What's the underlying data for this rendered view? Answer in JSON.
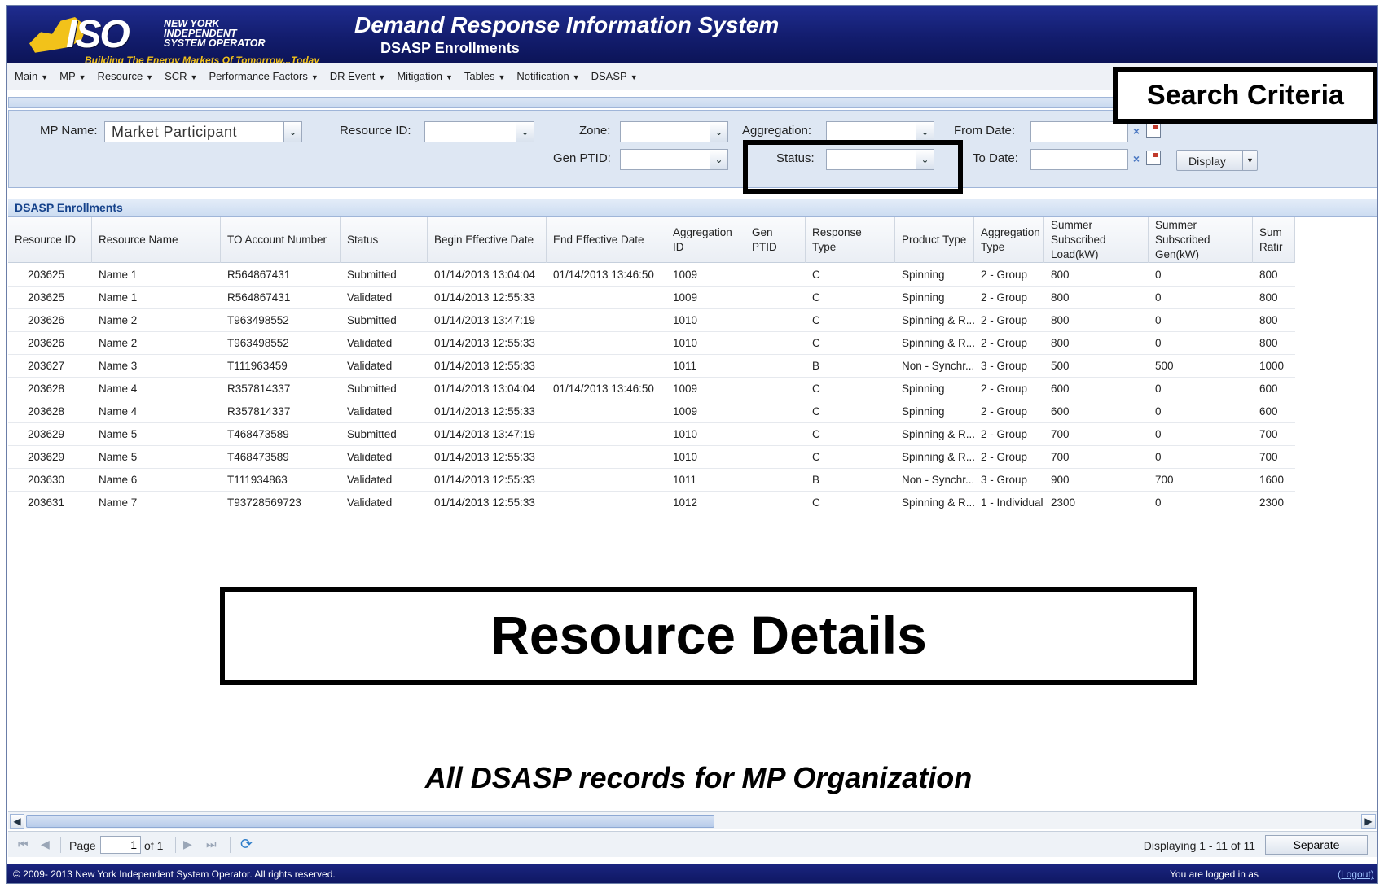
{
  "header": {
    "logo_text": "ISO",
    "org_name": "NEW YORK\nINDEPENDENT\nSYSTEM OPERATOR",
    "tagline": "Building The Energy Markets Of Tomorrow...Today",
    "title": "Demand Response Information System",
    "subtitle": "DSASP Enrollments"
  },
  "menu": [
    "Main",
    "MP",
    "Resource",
    "SCR",
    "Performance Factors",
    "DR Event",
    "Mitigation",
    "Tables",
    "Notification",
    "DSASP"
  ],
  "search": {
    "mp_name_label": "MP Name:",
    "mp_name_value": "Market Participant",
    "resource_id_label": "Resource ID:",
    "zone_label": "Zone:",
    "aggregation_label": "Aggregation:",
    "from_date_label": "From Date:",
    "gen_ptid_label": "Gen PTID:",
    "status_label": "Status:",
    "to_date_label": "To Date:",
    "display_button": "Display",
    "clear_symbol": "×",
    "dropdown_symbol": "⌄"
  },
  "annotations": {
    "search_criteria": "Search Criteria",
    "resource_details": "Resource Details",
    "caption": "All DSASP records for MP Organization"
  },
  "grid": {
    "title": "DSASP Enrollments",
    "columns": [
      "Resource ID",
      "Resource Name",
      "TO Account Number",
      "Status",
      "Begin Effective Date",
      "End Effective Date",
      "Aggregation ID",
      "Gen PTID",
      "Response Type",
      "Product Type",
      "Aggregation Type",
      "Summer Subscribed Load(kW)",
      "Summer Subscribed Gen(kW)",
      "Sum Ratir"
    ],
    "rows": [
      [
        "203625",
        "Name 1",
        "R564867431",
        "Submitted",
        "01/14/2013 13:04:04",
        "01/14/2013 13:46:50",
        "1009",
        "",
        "C",
        "Spinning",
        "2 - Group",
        "800",
        "0",
        "800"
      ],
      [
        "203625",
        "Name 1",
        "R564867431",
        "Validated",
        "01/14/2013 12:55:33",
        "",
        "1009",
        "",
        "C",
        "Spinning",
        "2 - Group",
        "800",
        "0",
        "800"
      ],
      [
        "203626",
        "Name 2",
        "T963498552",
        "Submitted",
        "01/14/2013 13:47:19",
        "",
        "1010",
        "",
        "C",
        "Spinning & R...",
        "2 - Group",
        "800",
        "0",
        "800"
      ],
      [
        "203626",
        "Name 2",
        "T963498552",
        "Validated",
        "01/14/2013 12:55:33",
        "",
        "1010",
        "",
        "C",
        "Spinning & R...",
        "2 - Group",
        "800",
        "0",
        "800"
      ],
      [
        "203627",
        "Name 3",
        "T111963459",
        "Validated",
        "01/14/2013 12:55:33",
        "",
        "1011",
        "",
        "B",
        "Non - Synchr...",
        "3 - Group",
        "500",
        "500",
        "1000"
      ],
      [
        "203628",
        "Name 4",
        "R357814337",
        "Submitted",
        "01/14/2013 13:04:04",
        "01/14/2013 13:46:50",
        "1009",
        "",
        "C",
        "Spinning",
        "2 - Group",
        "600",
        "0",
        "600"
      ],
      [
        "203628",
        "Name 4",
        "R357814337",
        "Validated",
        "01/14/2013 12:55:33",
        "",
        "1009",
        "",
        "C",
        "Spinning",
        "2 - Group",
        "600",
        "0",
        "600"
      ],
      [
        "203629",
        "Name 5",
        "T468473589",
        "Submitted",
        "01/14/2013 13:47:19",
        "",
        "1010",
        "",
        "C",
        "Spinning & R...",
        "2 - Group",
        "700",
        "0",
        "700"
      ],
      [
        "203629",
        "Name 5",
        "T468473589",
        "Validated",
        "01/14/2013 12:55:33",
        "",
        "1010",
        "",
        "C",
        "Spinning & R...",
        "2 - Group",
        "700",
        "0",
        "700"
      ],
      [
        "203630",
        "Name 6",
        "T111934863",
        "Validated",
        "01/14/2013 12:55:33",
        "",
        "1011",
        "",
        "B",
        "Non - Synchr...",
        "3 - Group",
        "900",
        "700",
        "1600"
      ],
      [
        "203631",
        "Name 7",
        "T93728569723",
        "Validated",
        "01/14/2013 12:55:33",
        "",
        "1012",
        "",
        "C",
        "Spinning & R...",
        "1 - Individual",
        "2300",
        "0",
        "2300"
      ]
    ]
  },
  "pager": {
    "page_label": "Page",
    "page_value": "1",
    "of_label": "of 1",
    "displaying": "Displaying 1 - 11 of 11",
    "separate_button": "Separate"
  },
  "footer": {
    "copyright": "© 2009- 2013 New York Independent System Operator. All rights reserved.",
    "logged_in": "You are logged in as",
    "logout": "(Logout)"
  },
  "colors": {
    "header_bg": "#131d6e",
    "accent_yellow": "#f2c21a",
    "panel_bg": "#dee7f3",
    "grid_title": "#15428b"
  }
}
